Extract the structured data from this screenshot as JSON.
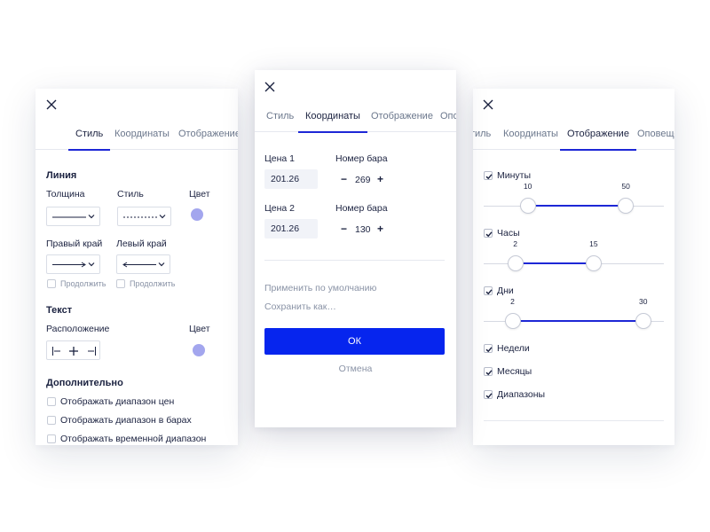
{
  "left_panel": {
    "tabs": [
      {
        "label": "Стиль",
        "active": true
      },
      {
        "label": "Координаты",
        "active": false
      },
      {
        "label": "Отображение",
        "active": false
      }
    ],
    "line_section": {
      "title": "Линия",
      "thickness_label": "Толщина",
      "style_label": "Стиль",
      "color_label": "Цвет",
      "right_edge_label": "Правый край",
      "left_edge_label": "Левый край",
      "extend_label": "Продолжить"
    },
    "text_section": {
      "title": "Текст",
      "position_label": "Расположение",
      "color_label": "Цвет"
    },
    "extra_section": {
      "title": "Дополнительно",
      "options": [
        {
          "label": "Отображать диапазон цен",
          "checked": false
        },
        {
          "label": "Отображать диапазон в барах",
          "checked": false
        },
        {
          "label": "Отображать временной диапазон",
          "checked": false
        }
      ]
    },
    "swatch_color": "#a3a6ee"
  },
  "middle_panel": {
    "tabs": [
      {
        "label": "Стиль",
        "active": false
      },
      {
        "label": "Координаты",
        "active": true
      },
      {
        "label": "Отображение",
        "active": false
      },
      {
        "label": "Опо",
        "active": false
      }
    ],
    "points": [
      {
        "price_label": "Цена 1",
        "price": "201.26",
        "bar_label": "Номер бара",
        "bar": "269"
      },
      {
        "price_label": "Цена 2",
        "price": "201.26",
        "bar_label": "Номер бара",
        "bar": "130"
      }
    ],
    "minus": "−",
    "plus": "+",
    "apply_default": "Применить по умолчанию",
    "save_as": "Сохранить как…",
    "ok_label": "ОК",
    "cancel_label": "Отмена",
    "accent_color": "#0625ee"
  },
  "right_panel": {
    "tabs": [
      {
        "label": "Стиль",
        "active": false
      },
      {
        "label": "Координаты",
        "active": false
      },
      {
        "label": "Отображение",
        "active": true
      },
      {
        "label": "Оповещения",
        "active": false
      }
    ],
    "ranges": [
      {
        "label": "Минуты",
        "checked": true,
        "min_label": "10",
        "max_label": "50",
        "scale_max": 59,
        "low": 10,
        "high": 50
      },
      {
        "label": "Часы",
        "checked": true,
        "min_label": "2",
        "max_label": "15",
        "scale_max": 24,
        "low": 2,
        "high": 15
      },
      {
        "label": "Дни",
        "checked": true,
        "min_label": "2",
        "max_label": "30",
        "scale_max": 31,
        "low": 2,
        "high": 30
      }
    ],
    "options": [
      {
        "label": "Недели",
        "checked": true
      },
      {
        "label": "Месяцы",
        "checked": true
      },
      {
        "label": "Диапазоны",
        "checked": true
      }
    ],
    "slider_color": "#1d27d6"
  }
}
